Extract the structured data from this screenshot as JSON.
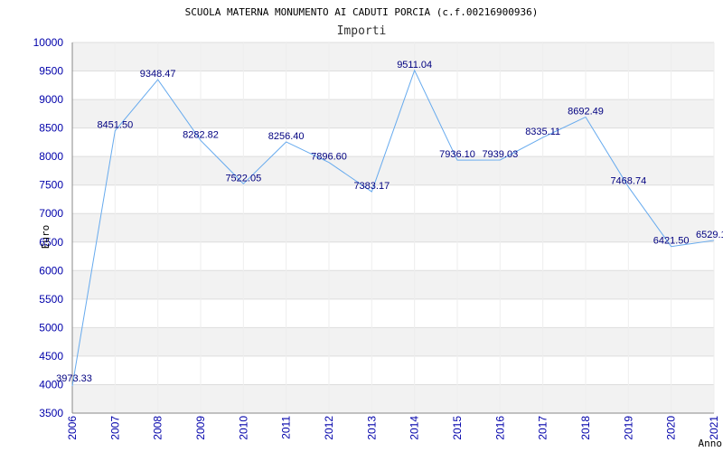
{
  "chart_data": {
    "type": "line",
    "title": "SCUOLA MATERNA MONUMENTO AI CADUTI PORCIA (c.f.00216900936)",
    "subtitle": "Importi",
    "xlabel": "Anno",
    "ylabel": "Euro",
    "x": [
      "2006",
      "2007",
      "2008",
      "2009",
      "2010",
      "2011",
      "2012",
      "2013",
      "2014",
      "2015",
      "2016",
      "2017",
      "2018",
      "2019",
      "2020",
      "2021"
    ],
    "series": [
      {
        "values": [
          3973.33,
          8451.5,
          9348.47,
          8282.82,
          7522.05,
          8256.4,
          7896.6,
          7383.17,
          9511.04,
          7936.1,
          7939.03,
          8335.11,
          8692.49,
          7468.74,
          6421.5,
          6529.1
        ],
        "labels": [
          "3973.33",
          "8451.50",
          "9348.47",
          "8282.82",
          "7522.05",
          "8256.40",
          "7896.60",
          "7383.17",
          "9511.04",
          "7936.10",
          "7939.03",
          "8335.11",
          "8692.49",
          "7468.74",
          "6421.50",
          "6529.1"
        ]
      }
    ],
    "yticks": [
      "3500",
      "4000",
      "4500",
      "5000",
      "5500",
      "6000",
      "6500",
      "7000",
      "7500",
      "8000",
      "8500",
      "9000",
      "9500",
      "10000"
    ],
    "ylim": [
      3500,
      10000
    ],
    "grid": true,
    "colors": {
      "line": "#66aaee",
      "band": "#f2f2f2",
      "tick_text": "#0000aa",
      "label_text": "#000080"
    }
  }
}
